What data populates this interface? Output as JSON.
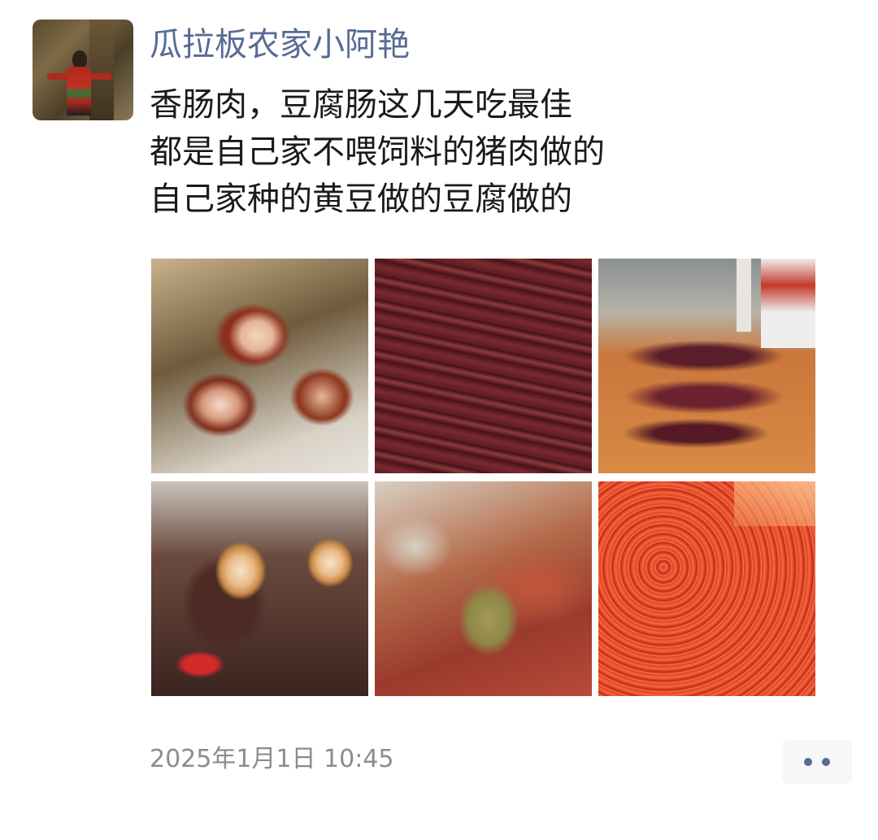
{
  "post": {
    "author": "瓜拉板农家小阿艳",
    "lines": [
      "香肠肉，豆腐肠这几天吃最佳",
      "都是自己家不喂饲料的猪肉做的",
      "自己家种的黄豆做的豆腐做的"
    ],
    "photos": [
      {
        "name": "sliced-sausage-photo"
      },
      {
        "name": "hanging-sausages-photo"
      },
      {
        "name": "coiled-sausages-photo"
      },
      {
        "name": "tofu-sausage-photo"
      },
      {
        "name": "seasoned-meat-photo"
      },
      {
        "name": "chili-meat-photo"
      }
    ],
    "timestamp": "2025年1月1日 10:45"
  },
  "colors": {
    "author_name": "#576b95",
    "timestamp": "#8c8c8c",
    "more_dots": "#576b95"
  }
}
